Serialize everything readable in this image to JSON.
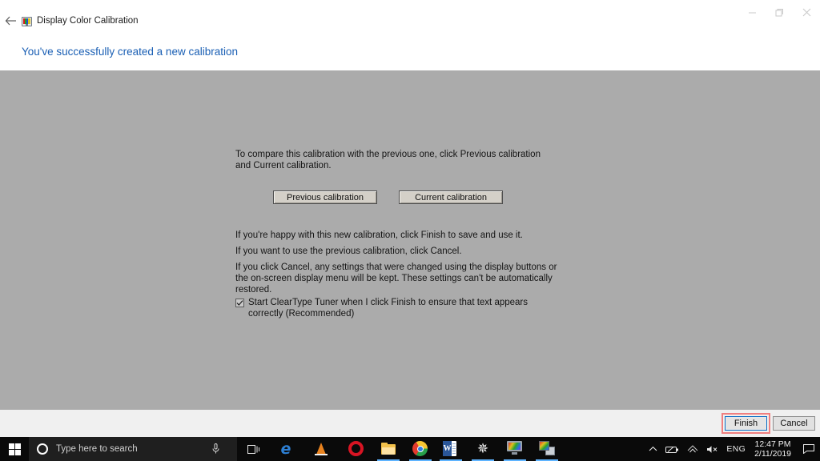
{
  "window": {
    "title": "Display Color Calibration",
    "app_icon": "display-monitor-icon",
    "back_label": "←",
    "minimize_label": "minimize",
    "restore_label": "restore",
    "close_label": "close"
  },
  "heading": "You've successfully created a new calibration",
  "content": {
    "intro": "To compare this calibration with the previous one, click Previous calibration and Current calibration.",
    "previous_button": "Previous calibration",
    "current_button": "Current calibration",
    "p_happy": "If you're happy with this new calibration, click Finish to save and use it.",
    "p_previous": "If you want to use the previous calibration, click Cancel.",
    "p_cancel": "If you click Cancel, any settings that were changed using the display buttons or the on-screen display menu will be kept. These settings can't be automatically restored.",
    "cleartype_label": "Start ClearType Tuner when I click Finish to ensure that text appears correctly (Recommended)",
    "cleartype_checked": true
  },
  "footer": {
    "finish_label": "Finish",
    "cancel_label": "Cancel",
    "finish_focus_color": "#0a6cc4",
    "finish_highlight_color": "#f08080"
  },
  "taskbar": {
    "start_label": "Start",
    "search_placeholder": "Type here to search",
    "cortana_label": "Cortana",
    "mic_label": "microphone",
    "taskview_label": "Task View",
    "apps": [
      {
        "name": "microsoft-edge",
        "glyph": "e",
        "running": false
      },
      {
        "name": "vlc-media-player",
        "glyph": "",
        "running": false
      },
      {
        "name": "opera-browser",
        "glyph": "",
        "running": false
      },
      {
        "name": "file-explorer",
        "glyph": "",
        "running": true
      },
      {
        "name": "google-chrome",
        "glyph": "",
        "running": true
      },
      {
        "name": "microsoft-word",
        "glyph": "W",
        "running": true
      },
      {
        "name": "settings",
        "glyph": "⚙",
        "running": true
      },
      {
        "name": "display-color-calibration",
        "glyph": "",
        "running": true
      },
      {
        "name": "display-calibration-window",
        "glyph": "",
        "running": true
      }
    ],
    "tray": {
      "chevron": "⌃",
      "battery": "battery-icon",
      "network": "wifi-icon",
      "volume": "speaker-muted-icon",
      "language": "ENG",
      "time": "12:47 PM",
      "date": "2/11/2019",
      "action_center": "notifications-icon"
    }
  },
  "colors": {
    "panel_gray": "#ababab",
    "heading_blue": "#1a5fb4",
    "taskbar": "#0a0a0a",
    "footer": "#f0f0f0"
  }
}
